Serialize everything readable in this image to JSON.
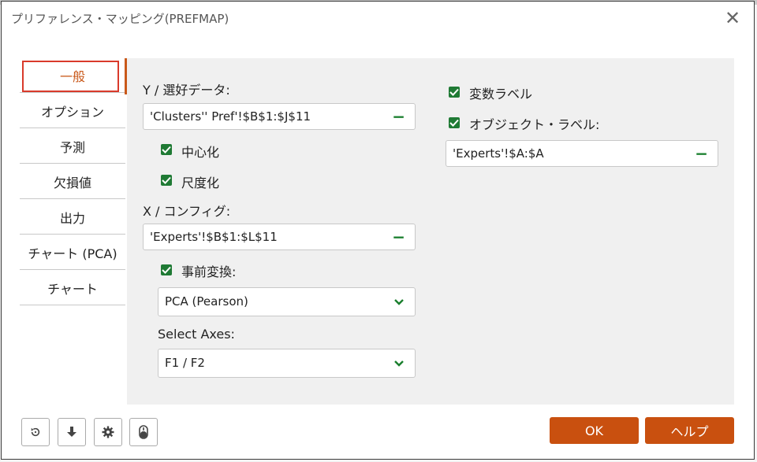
{
  "window": {
    "title": "プリファレンス・マッピング(PREFMAP)",
    "close_glyph": "✕"
  },
  "sidebar": {
    "items": [
      {
        "label": "一般"
      },
      {
        "label": "オプション"
      },
      {
        "label": "予測"
      },
      {
        "label": "欠損値"
      },
      {
        "label": "出力"
      },
      {
        "label": "チャート (PCA)"
      },
      {
        "label": "チャート"
      }
    ],
    "active_index": 0
  },
  "general": {
    "y_label": "Y / 選好データ:",
    "y_value": "'Clusters'' Pref'!$B$1:$J$11",
    "center_label": "中心化",
    "center_checked": true,
    "scale_label": "尺度化",
    "scale_checked": true,
    "x_label": "X / コンフィグ:",
    "x_value": "'Experts'!$B$1:$L$11",
    "pretransform_label": "事前変換:",
    "pretransform_checked": true,
    "pretransform_value": "PCA (Pearson)",
    "axes_label": "Select Axes:",
    "axes_value": "F1 / F2",
    "var_labels_label": "変数ラベル",
    "var_labels_checked": true,
    "obj_labels_label": "オブジェクト・ラベル:",
    "obj_labels_checked": true,
    "obj_labels_value": "'Experts'!$A:$A",
    "minus_glyph": "−"
  },
  "footer": {
    "icons": [
      "reset-icon",
      "download-icon",
      "gear-icon",
      "mouse-icon"
    ],
    "ok_label": "OK",
    "help_label": "ヘルプ"
  },
  "colors": {
    "accent": "#c9500f",
    "check": "#1f7a34",
    "minus": "#1a7f2e",
    "highlight_border": "#d93a2b"
  }
}
